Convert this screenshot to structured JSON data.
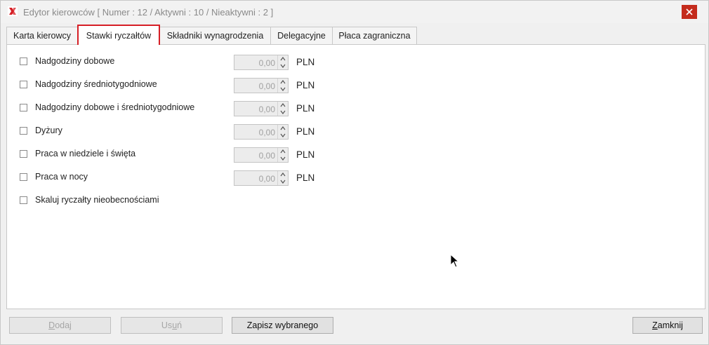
{
  "window": {
    "title": "Edytor kierowców [ Numer : 12 / Aktywni : 10 / Nieaktywni : 2 ]",
    "icon": "app-logo-icon",
    "close_icon": "close-icon"
  },
  "tabs": [
    {
      "label": "Karta kierowcy",
      "active": false
    },
    {
      "label": "Stawki ryczałtów",
      "active": true
    },
    {
      "label": "Składniki wynagrodzenia",
      "active": false
    },
    {
      "label": "Delegacyjne",
      "active": false
    },
    {
      "label": "Płaca zagraniczna",
      "active": false
    }
  ],
  "rates": [
    {
      "label": "Nadgodziny dobowe",
      "checked": false,
      "value": "0,00",
      "unit": "PLN"
    },
    {
      "label": "Nadgodziny średniotygodniowe",
      "checked": false,
      "value": "0,00",
      "unit": "PLN"
    },
    {
      "label": "Nadgodziny dobowe i średniotygodniowe",
      "checked": false,
      "value": "0,00",
      "unit": "PLN"
    },
    {
      "label": "Dyżury",
      "checked": false,
      "value": "0,00",
      "unit": "PLN"
    },
    {
      "label": "Praca w niedziele i święta",
      "checked": false,
      "value": "0,00",
      "unit": "PLN"
    },
    {
      "label": "Praca w nocy",
      "checked": false,
      "value": "0,00",
      "unit": "PLN"
    }
  ],
  "scale_option": {
    "label": "Skaluj ryczałty nieobecnościami",
    "checked": false
  },
  "buttons": {
    "add": {
      "mnemonic": "D",
      "rest": "odaj",
      "enabled": false
    },
    "remove": {
      "prefix": "Us",
      "mnemonic": "u",
      "rest": "ń",
      "enabled": false
    },
    "save": {
      "label": "Zapisz wybranego",
      "enabled": true
    },
    "close": {
      "mnemonic": "Z",
      "rest": "amknij",
      "enabled": true
    }
  },
  "colors": {
    "active_tab_border": "#d61f26",
    "close_button": "#c42b1c"
  }
}
